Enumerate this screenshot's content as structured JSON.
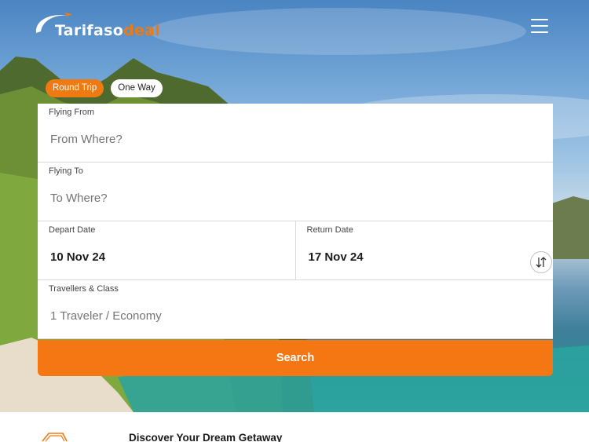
{
  "brand": {
    "name_main": "Tarifaso",
    "name_accent": "deal",
    "accent_color": "#f07a12"
  },
  "header": {
    "menu_icon": "hamburger-menu-icon"
  },
  "trip_types": {
    "round_trip": "Round Trip",
    "one_way": "One Way",
    "selected": "Round Trip"
  },
  "form": {
    "from": {
      "label": "Flying From",
      "placeholder": "From Where?"
    },
    "to": {
      "label": "Flying To",
      "placeholder": "To Where?"
    },
    "depart": {
      "label": "Depart Date",
      "value": "10 Nov 24"
    },
    "return": {
      "label": "Return Date",
      "value": "17 Nov 24"
    },
    "travellers": {
      "label": "Travellers & Class",
      "placeholder": "1 Traveler / Economy"
    },
    "swap_icon": "swap-arrows-icon",
    "search_label": "Search"
  },
  "section": {
    "heading": "Discover Your Dream Getaway",
    "icon": "plane-icon"
  }
}
